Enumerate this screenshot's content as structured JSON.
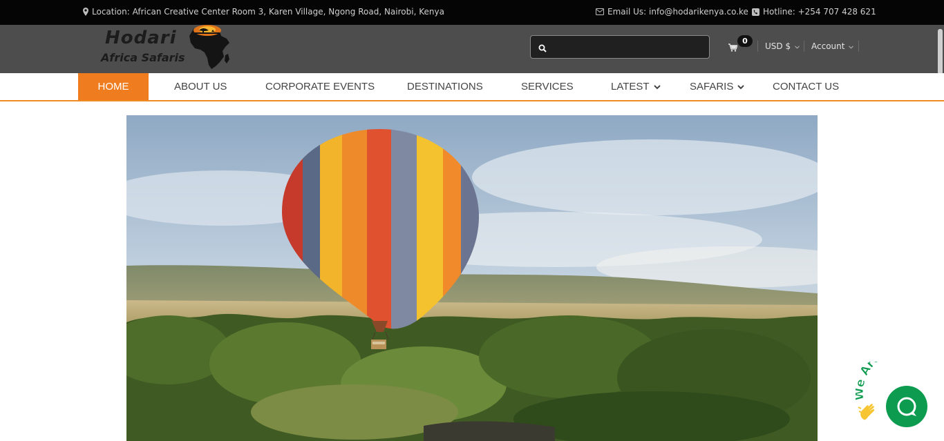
{
  "topbar": {
    "location": "Location: African Creative Center Room 3, Karen Village, Ngong Road, Nairobi, Kenya",
    "email": "Email Us: info@hodarikenya.co.ke",
    "hotline": "Hotline: +254 707 428 621"
  },
  "header": {
    "logo_line1": "Hodari",
    "logo_line2": "Africa Safaris",
    "search_placeholder": "",
    "cart_count": "0",
    "currency": "USD $",
    "account": "Account"
  },
  "nav": {
    "items": [
      {
        "label": "HOME",
        "active": true
      },
      {
        "label": "ABOUT US"
      },
      {
        "label": "CORPORATE EVENTS"
      },
      {
        "label": "DESTINATIONS"
      },
      {
        "label": "SERVICES"
      },
      {
        "label": "LATEST",
        "dropdown": true
      },
      {
        "label": "SAFARIS",
        "dropdown": true
      },
      {
        "label": "CONTACT US"
      }
    ]
  },
  "chat": {
    "badge_text": "We Are Here!",
    "icons": [
      "waving-hand-icon",
      "chat-bubble-icon"
    ]
  },
  "colors": {
    "accent": "#ef7d1f",
    "topbar": "#050505",
    "header": "#4d4d4d",
    "chat": "#0c9b4f"
  }
}
